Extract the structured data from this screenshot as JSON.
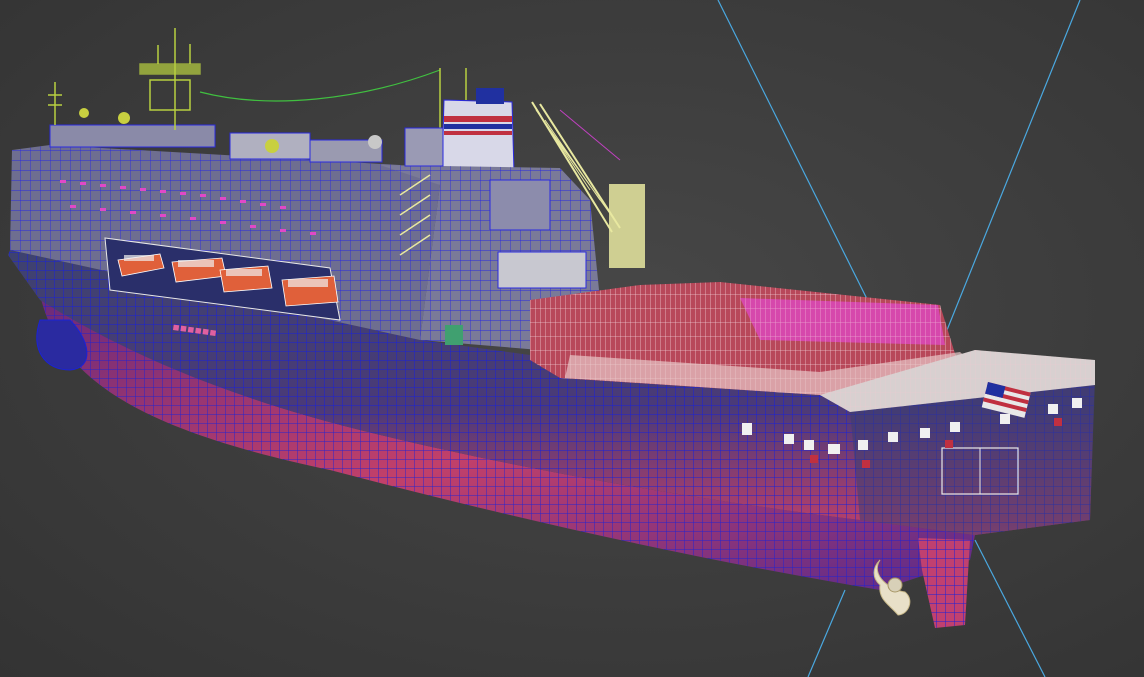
{
  "viewport": {
    "background": "#3b3b3b",
    "wire_color": "#1a22d8",
    "mesh": "container-ship-wireframe"
  },
  "colors": {
    "hull_upper": "#3e4270",
    "hull_lower": "#7a3a6a",
    "hull_bottom": "#c0406a",
    "superstructure": "#707090",
    "containers": "#b8485a",
    "containers_highlight": "#e048c8",
    "crane": "#e8e8a0",
    "lifeboats": "#e0603a",
    "camera_lines": "#4aa8e0",
    "funnel_stripe_red": "#c03040",
    "funnel_stripe_blue": "#2030a0",
    "mast_green": "#b8d040"
  }
}
